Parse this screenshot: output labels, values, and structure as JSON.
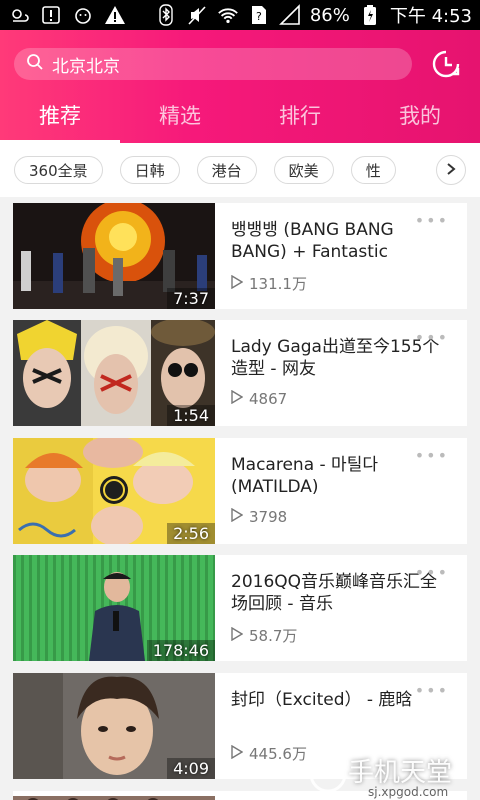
{
  "status_bar": {
    "battery": "86%",
    "time": "下午 4:53",
    "left_icons": [
      "weather-icon",
      "warning-icon",
      "cat-icon",
      "alert-icon"
    ],
    "right_icons": [
      "bluetooth-icon",
      "mute-icon",
      "wifi-icon",
      "sim-icon",
      "signal-icon",
      "battery-icon"
    ]
  },
  "header": {
    "search_text": "北京北京",
    "tabs": [
      {
        "label": "推荐",
        "active": true
      },
      {
        "label": "精选",
        "active": false
      },
      {
        "label": "排行",
        "active": false
      },
      {
        "label": "我的",
        "active": false
      }
    ]
  },
  "categories": [
    "360全景",
    "日韩",
    "港台",
    "欧美",
    "性"
  ],
  "videos": [
    {
      "title": "뱅뱅뱅 (BANG BANG BANG) + Fantastic",
      "plays": "131.1万",
      "duration": "7:37"
    },
    {
      "title": "Lady Gaga出道至今155个造型 - 网友",
      "plays": "4867",
      "duration": "1:54"
    },
    {
      "title": "Macarena - 마틸다 (MATILDA)",
      "plays": "3798",
      "duration": "2:56"
    },
    {
      "title": "2016QQ音乐巅峰音乐汇全场回顾 - 音乐",
      "plays": "58.7万",
      "duration": "178:46"
    },
    {
      "title": "封印（Excited） - 鹿晗",
      "plays": "445.6万",
      "duration": "4:09"
    }
  ],
  "watermark": {
    "brand": "手机天堂",
    "url": "sj.xpgod.com"
  },
  "colors": {
    "accent": "#f6197a",
    "accent_dark": "#e6136f"
  }
}
